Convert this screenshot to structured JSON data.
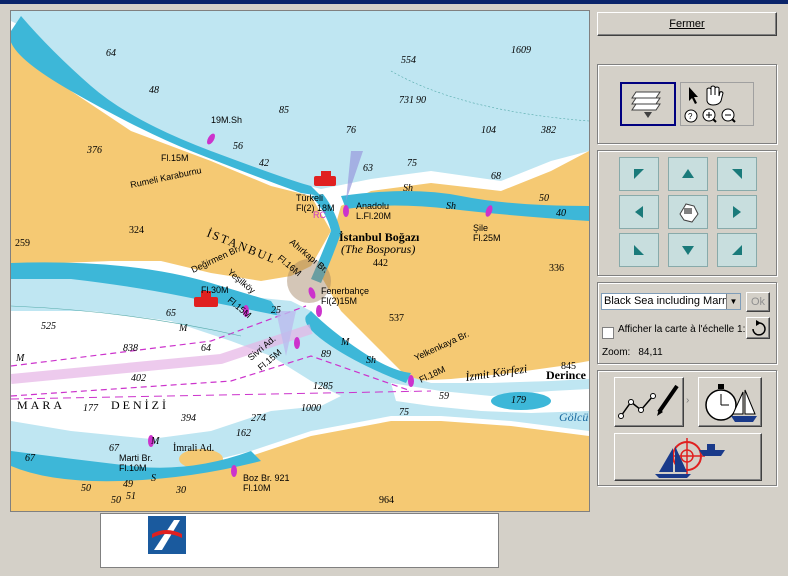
{
  "window": {
    "close_label": "Fermer"
  },
  "chart": {
    "place_labels": [
      "İSTANBUL",
      "İstanbul Boğazı",
      "(The Bosporus)",
      "MARA",
      "DENİZİ",
      "İzmit Körfezi",
      "Derince",
      "Gölcü",
      "İmrali Ad."
    ],
    "light_labels": [
      "Rumeli Karaburnu",
      "Fl.15M",
      "Türkeli",
      "Fl(2) 18M",
      "Anadolu",
      "L.Fl.20M",
      "Şile",
      "Fl.25M",
      "Ahırkapı Br.",
      "Fl.16M",
      "Değirmen Br.",
      "Fl.30M",
      "Yeşilköy",
      "Fl.15M",
      "Fenerbahçe",
      "Fl(2)15M",
      "Sivri Ad.",
      "Fl.15M",
      "Yelkenkaya Br.",
      "Fl.18M",
      "Marti Br.",
      "Fl.10M",
      "Boz Br. 921",
      "Fl.10M",
      "RC",
      "19M.Sh"
    ],
    "soundings": [
      "64",
      "48",
      "554",
      "1609",
      "731",
      "85",
      "90",
      "104",
      "382",
      "376",
      "76",
      "56",
      "42",
      "63",
      "75",
      "68",
      "Sh",
      "50",
      "Sh",
      "40",
      "324",
      "259",
      "442",
      "336",
      "537",
      "525",
      "838",
      "M",
      "64",
      "M",
      "89",
      "M",
      "Sh",
      "845",
      "402",
      "1285",
      "1000",
      "75",
      "59",
      "179",
      "177",
      "394",
      "274",
      "M",
      "67",
      "162",
      "67",
      "S",
      "30",
      "964",
      "49",
      "50",
      "65",
      "51",
      "50",
      "25"
    ]
  },
  "logo": {
    "text": "ARCS"
  },
  "tools": {
    "layers_icon": "layers-icon",
    "select_icon": "arrow-cursor-icon",
    "pan_icon": "hand-icon",
    "query_icon": "query-icon",
    "zoom_in_icon": "zoom-in-icon",
    "zoom_out_icon": "zoom-out-icon"
  },
  "chart_select": {
    "value": "Black Sea including Marma",
    "ok_label": "Ok",
    "scale_label": "Afficher la carte à l'échelle 1:1",
    "scale_checked": false
  },
  "zoom": {
    "label": "Zoom:",
    "value": "84,11"
  },
  "colors": {
    "land": "#f5c973",
    "shallow": "#3db7d8",
    "medium": "#bfe6f2",
    "deep": "#ffffff",
    "nav_button": "#c8dede",
    "accent": "#000080"
  }
}
